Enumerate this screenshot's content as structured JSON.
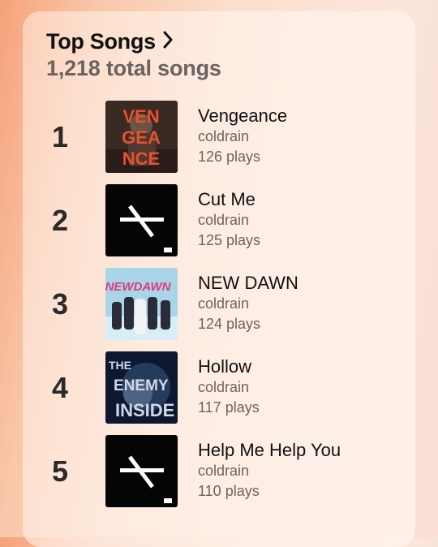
{
  "header": {
    "title": "Top Songs",
    "subtitle": "1,218 total songs"
  },
  "songs": [
    {
      "rank": "1",
      "title": "Vengeance",
      "artist": "coldrain",
      "plays": "126 plays",
      "art_letters": [
        "VEN",
        "GEA",
        "NCE"
      ],
      "art_colors": {
        "bg": "#3a2a24",
        "text": "#e8512e"
      }
    },
    {
      "rank": "2",
      "title": "Cut Me",
      "artist": "coldrain",
      "plays": "125 plays",
      "art_icon": "cross-bar-logo-icon",
      "art_colors": {
        "bg": "#050505",
        "fg": "#ffffff"
      }
    },
    {
      "rank": "3",
      "title": "NEW DAWN",
      "artist": "coldrain",
      "plays": "124 plays",
      "art_letters": [
        "NEWDAWN"
      ],
      "art_colors": {
        "bg": "#a8d6e8",
        "text": "#e03a78"
      }
    },
    {
      "rank": "4",
      "title": "Hollow",
      "artist": "coldrain",
      "plays": "117 plays",
      "art_letters": [
        "THE",
        "ENEMY",
        "INSIDE"
      ],
      "art_colors": {
        "bg": "#0d1830",
        "text": "#cfd8e6"
      }
    },
    {
      "rank": "5",
      "title": "Help Me Help You",
      "artist": "coldrain",
      "plays": "110 plays",
      "art_icon": "cross-bar-logo-icon",
      "art_colors": {
        "bg": "#050505",
        "fg": "#ffffff"
      }
    }
  ]
}
